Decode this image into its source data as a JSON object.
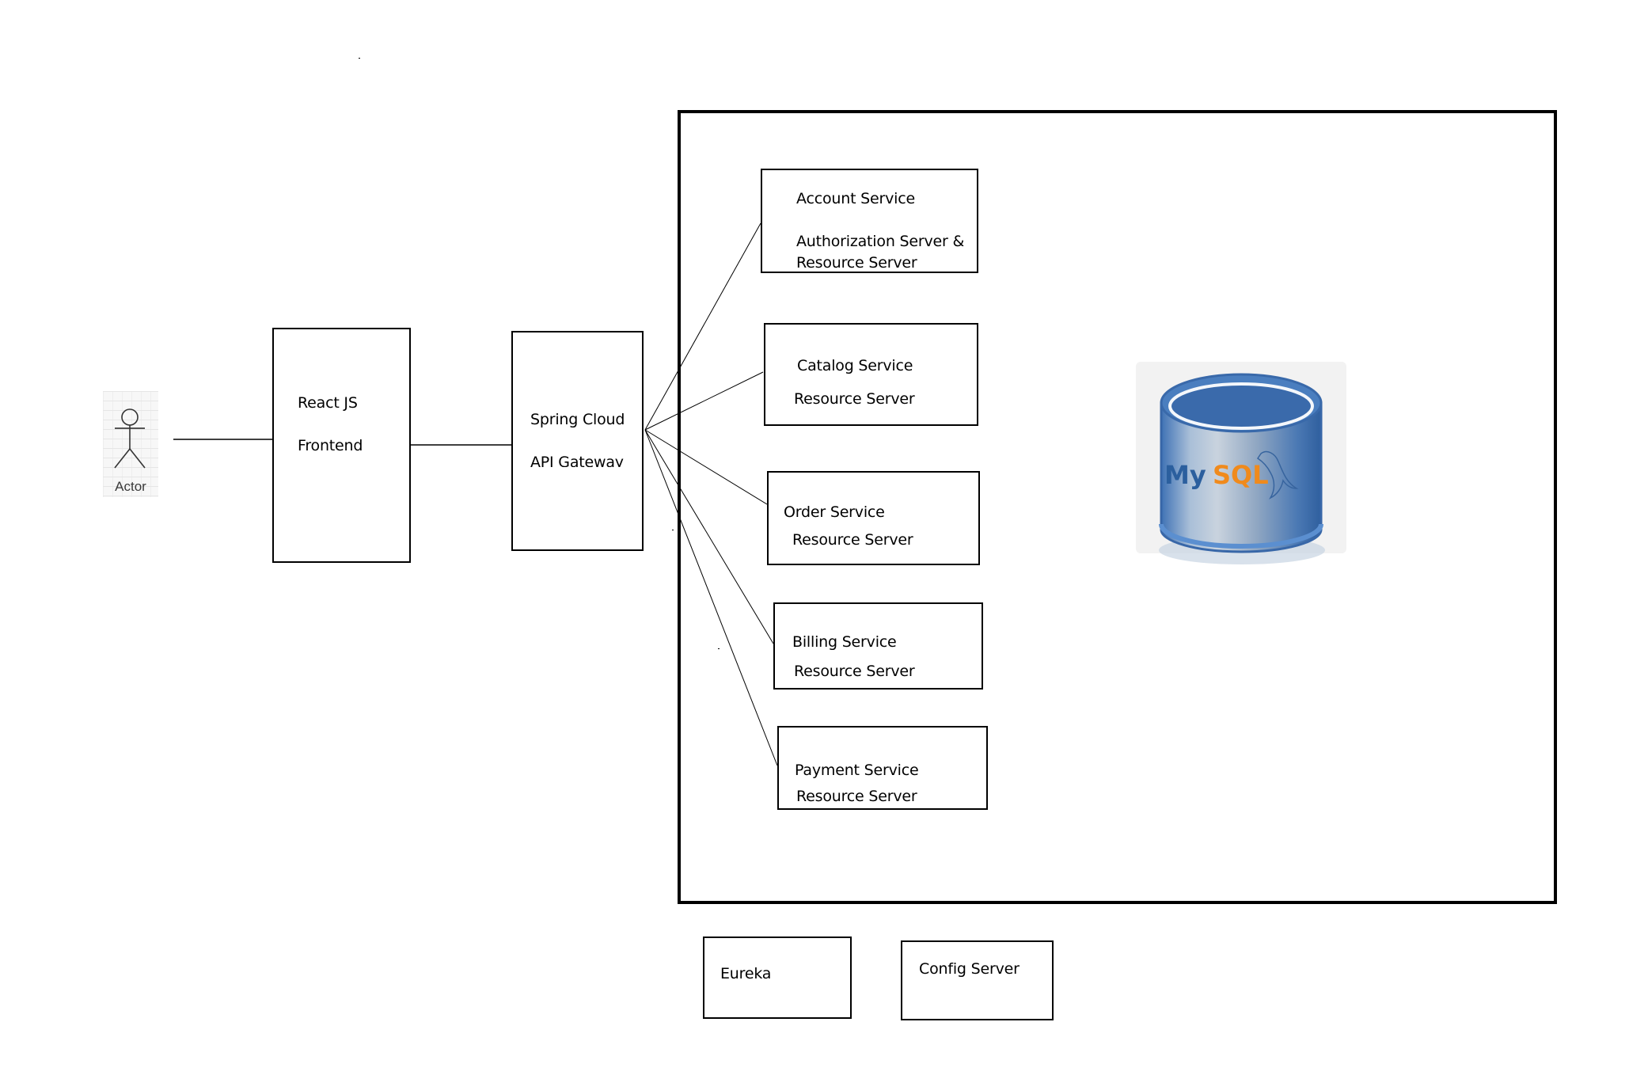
{
  "diagram": {
    "actor": {
      "label": "Actor",
      "icon": "stick-figure-icon"
    },
    "frontend": {
      "line1": "React JS",
      "line2": "Frontend"
    },
    "gateway": {
      "line1": "Spring Cloud",
      "line2": "API Gateway"
    },
    "services": [
      {
        "name": "Account Service",
        "role_line1": "Authorization Server &",
        "role_line2": "Resource Server"
      },
      {
        "name": "Catalog Service",
        "role": "Resource Server"
      },
      {
        "name": "Order Service",
        "role": "Resource Server"
      },
      {
        "name": "Billing Service",
        "role": "Resource Server"
      },
      {
        "name": "Payment Service",
        "role": "Resource Server"
      }
    ],
    "database": {
      "logo_text_my": "My",
      "logo_text_sql": "SQL",
      "icon": "mysql-database-icon",
      "colors": {
        "my": "#2b5f9e",
        "sql": "#f08a1c",
        "cylinder": "#4a7ebf"
      }
    },
    "infrastructure": [
      {
        "label": "Eureka"
      },
      {
        "label": "Config Server"
      }
    ]
  }
}
